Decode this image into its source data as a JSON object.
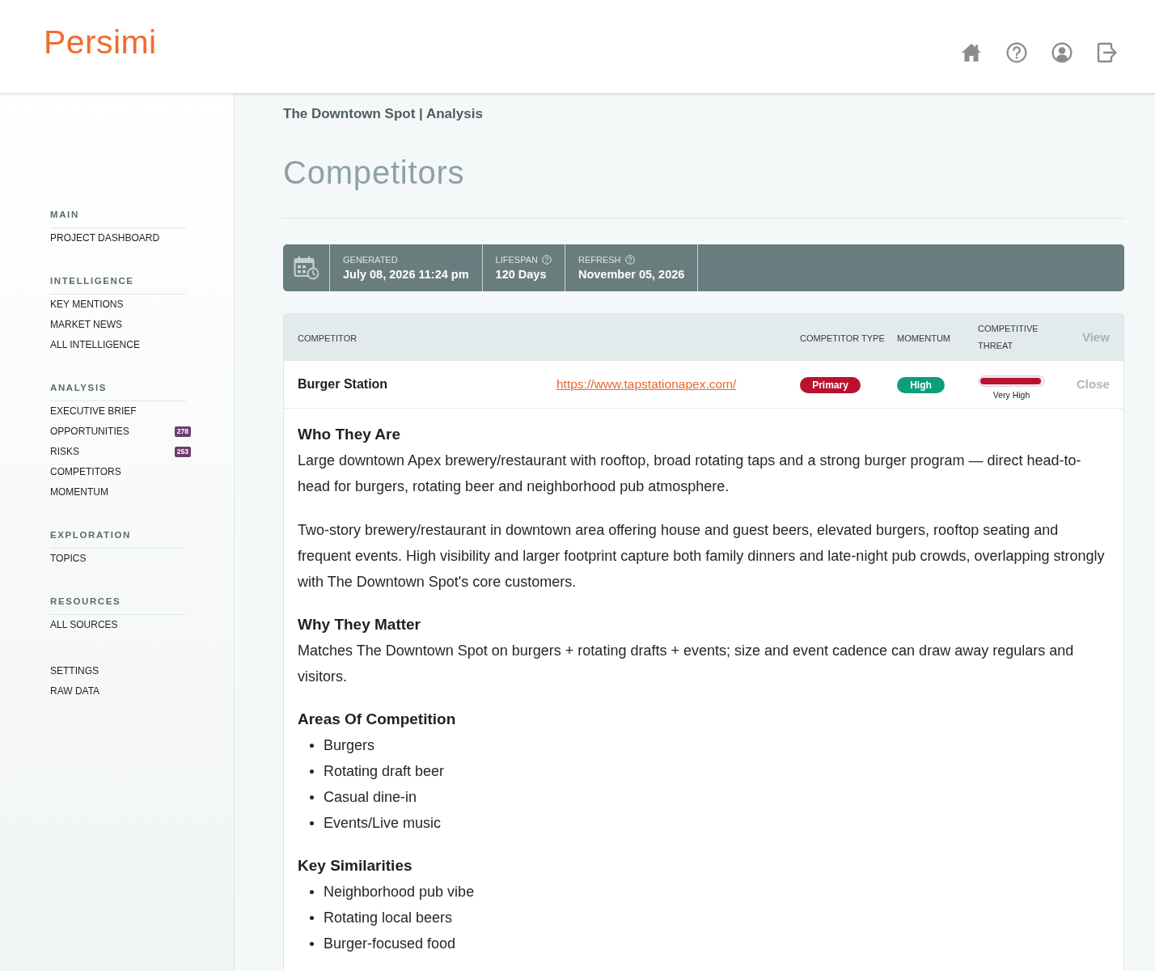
{
  "header": {
    "logo": "Persimi"
  },
  "sidebar": {
    "sections": [
      {
        "heading": "MAIN",
        "items": [
          {
            "label": "PROJECT DASHBOARD"
          }
        ]
      },
      {
        "heading": "INTELLIGENCE",
        "items": [
          {
            "label": "KEY MENTIONS"
          },
          {
            "label": "MARKET NEWS"
          },
          {
            "label": "ALL INTELLIGENCE"
          }
        ]
      },
      {
        "heading": "ANALYSIS",
        "items": [
          {
            "label": "EXECUTIVE BRIEF"
          },
          {
            "label": "OPPORTUNITIES",
            "badge": "278"
          },
          {
            "label": "RISKS",
            "badge": "253"
          },
          {
            "label": "COMPETITORS"
          },
          {
            "label": "MOMENTUM"
          }
        ]
      },
      {
        "heading": "EXPLORATION",
        "items": [
          {
            "label": "TOPICS"
          }
        ]
      },
      {
        "heading": "RESOURCES",
        "items": [
          {
            "label": "ALL SOURCES"
          }
        ]
      },
      {
        "items": [
          {
            "label": "SETTINGS"
          },
          {
            "label": "RAW DATA"
          }
        ]
      }
    ]
  },
  "breadcrumb": "The Downtown Spot | Analysis",
  "page_title": "Competitors",
  "info_bar": {
    "fields": [
      {
        "label": "GENERATED",
        "value": "July 08, 2026 11:24 pm",
        "help": false
      },
      {
        "label": "LIFESPAN",
        "value": "120 Days",
        "help": true
      },
      {
        "label": "REFRESH",
        "value": "November 05, 2026",
        "help": true
      }
    ]
  },
  "table": {
    "columns": [
      "COMPETITOR",
      "COMPETITOR TYPE",
      "MOMENTUM",
      "COMPETITIVE THREAT",
      "View"
    ],
    "rows": [
      {
        "name": "Burger Station",
        "url": "https://www.tapstationapex.com/",
        "type": {
          "label": "Primary",
          "color": "#b8122e"
        },
        "momentum": {
          "label": "High",
          "color": "#0e9e7c"
        },
        "threat": {
          "level": 0.97,
          "label": "Very High"
        },
        "action": "Close",
        "expanded": true,
        "details": [
          {
            "kind": "text",
            "heading": "Who They Are",
            "paragraphs": [
              "Large downtown Apex brewery/restaurant with rooftop, broad rotating taps and a strong burger program — direct head-to-head for burgers, rotating beer and neighborhood pub atmosphere.",
              "Two-story brewery/restaurant in downtown area offering house and guest beers, elevated burgers, rooftop seating and frequent events. High visibility and larger footprint capture both family dinners and late-night pub crowds, overlapping strongly with The Downtown Spot's core customers."
            ]
          },
          {
            "kind": "text",
            "heading": "Why They Matter",
            "paragraphs": [
              "Matches The Downtown Spot on burgers + rotating drafts + events; size and event cadence can draw away regulars and visitors."
            ]
          },
          {
            "kind": "list",
            "heading": "Areas Of Competition",
            "items": [
              "Burgers",
              "Rotating draft beer",
              "Casual dine-in",
              "Events/Live music"
            ]
          },
          {
            "kind": "list",
            "heading": "Key Similarities",
            "items": [
              "Neighborhood pub vibe",
              "Rotating local beers",
              "Burger-focused food"
            ]
          }
        ]
      }
    ]
  }
}
